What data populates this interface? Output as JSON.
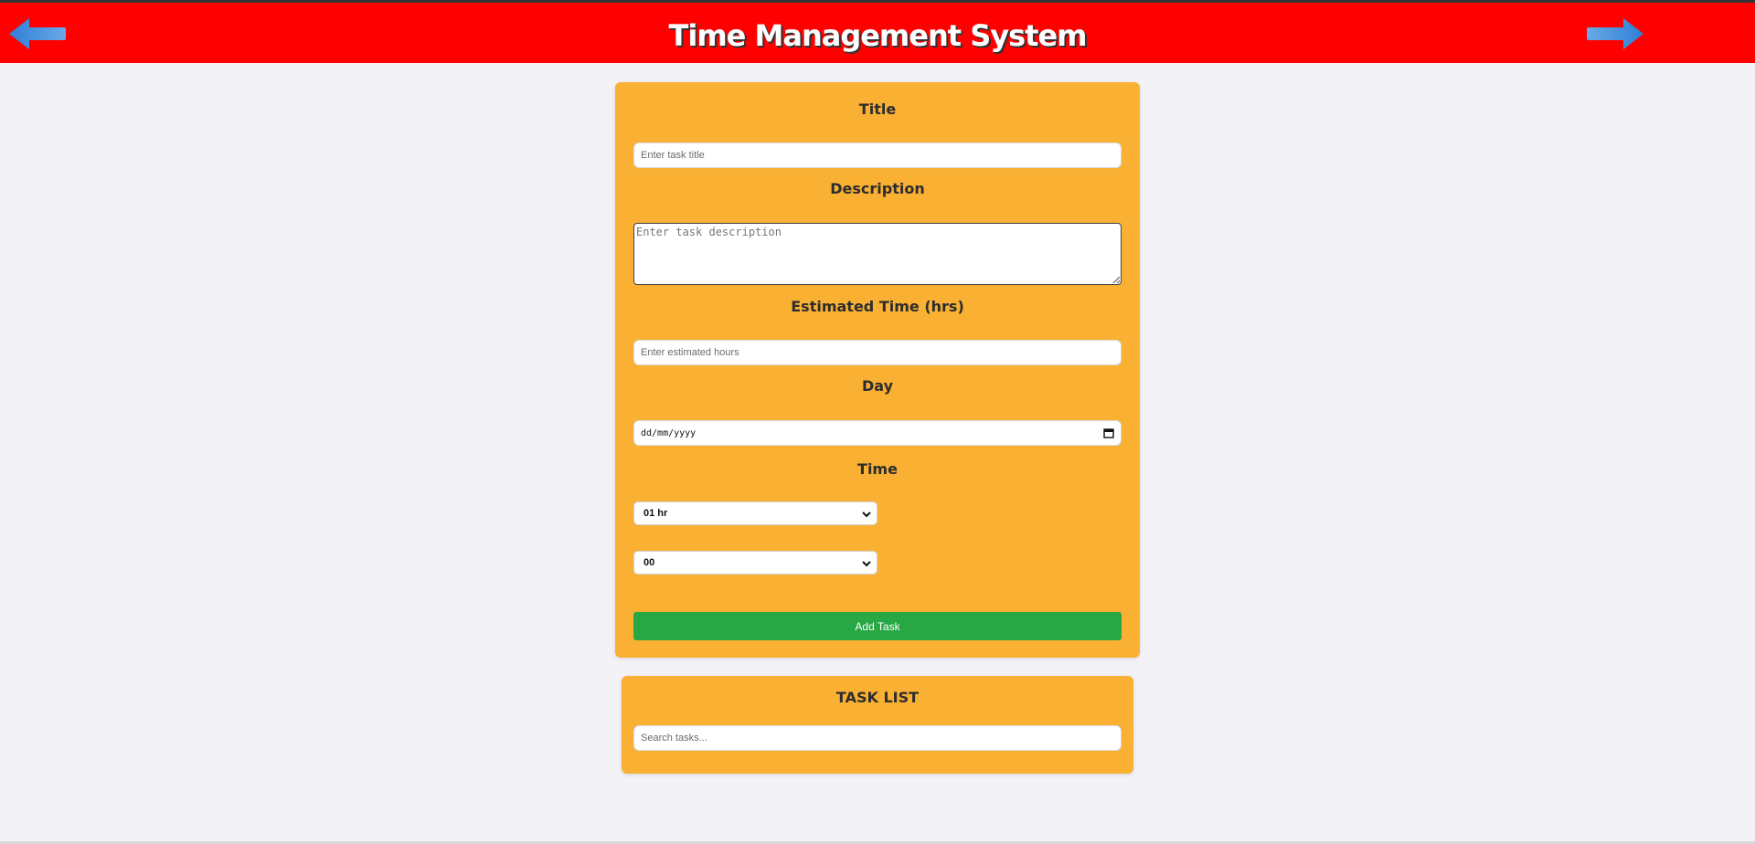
{
  "header": {
    "title": "Time Management System",
    "back_icon": "arrow-left-icon",
    "forward_icon": "arrow-right-icon",
    "background_color": "#ff0000"
  },
  "form": {
    "title_label": "Title",
    "title_placeholder": "Enter task title",
    "description_label": "Description",
    "description_placeholder": "Enter task description",
    "estimated_time_label": "Estimated Time (hrs)",
    "estimated_time_placeholder": "Enter estimated hours",
    "day_label": "Day",
    "day_placeholder": "dd/mm/yyyy",
    "time_label": "Time",
    "hour_selected": "01 hr",
    "minute_selected": "00",
    "add_button_label": "Add Task",
    "card_color": "#f9b033",
    "button_color": "#28a745"
  },
  "task_list": {
    "title": "TASK LIST",
    "search_placeholder": "Search tasks..."
  }
}
